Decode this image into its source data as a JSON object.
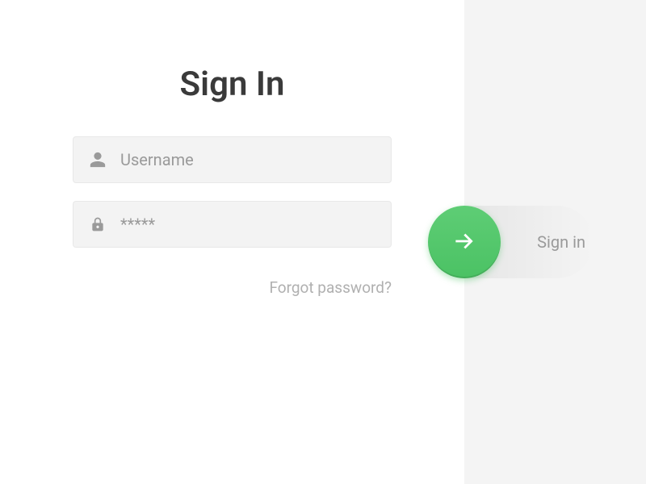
{
  "title": "Sign In",
  "form": {
    "username": {
      "placeholder": "Username",
      "value": ""
    },
    "password": {
      "placeholder": "",
      "value": "*****"
    },
    "forgot_label": "Forgot password?"
  },
  "action": {
    "signin_label": "Sign in"
  },
  "colors": {
    "accent": "#4bc264",
    "muted": "#9a9a9a",
    "input_bg": "#f3f3f3",
    "right_bg": "#f4f4f4"
  }
}
